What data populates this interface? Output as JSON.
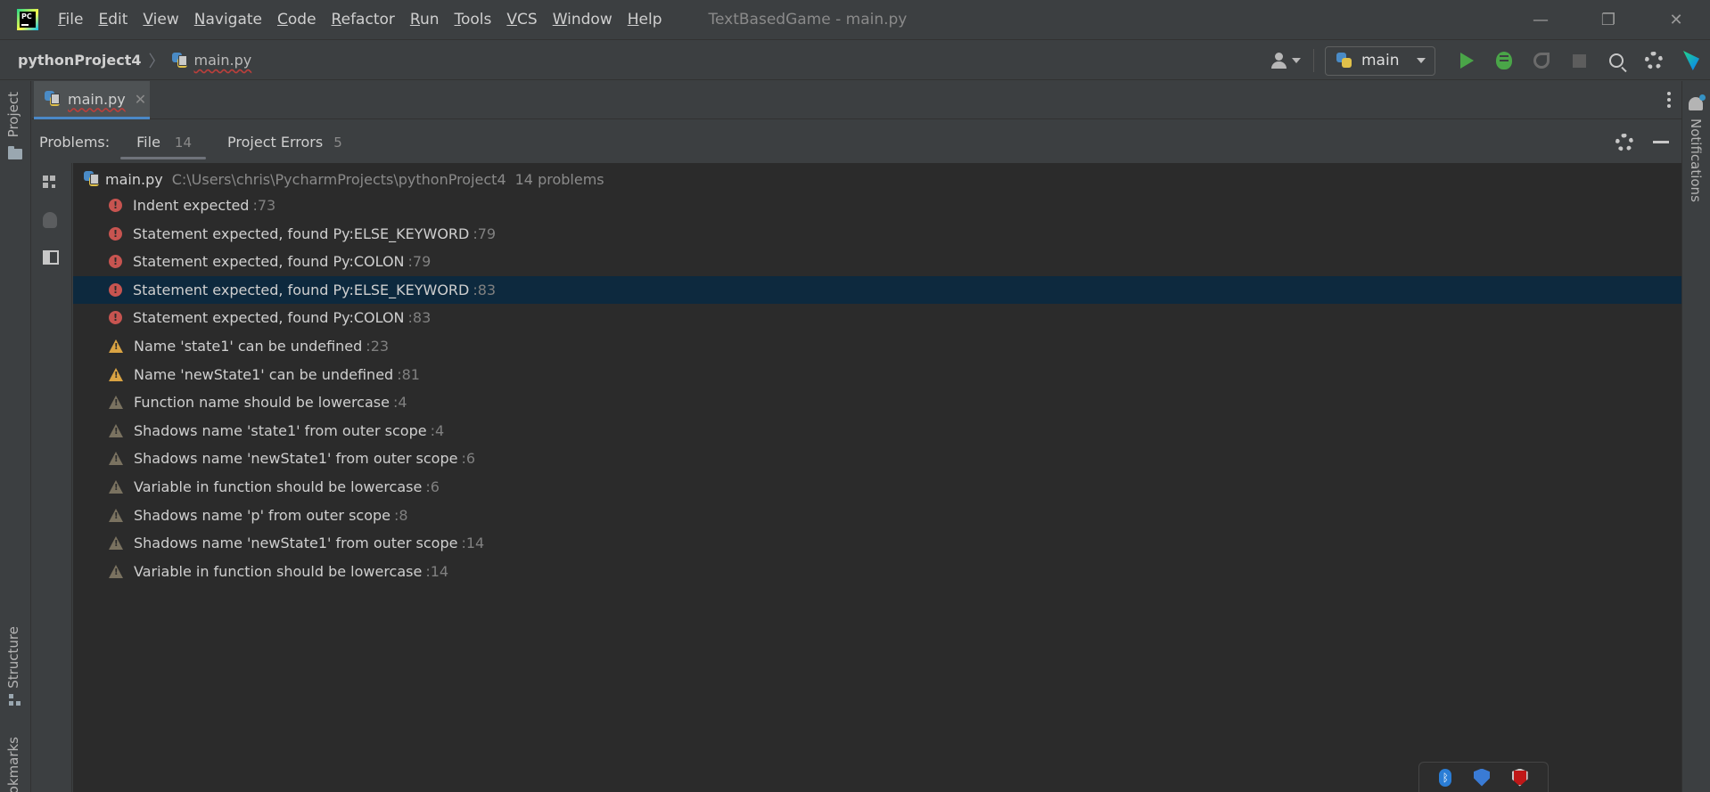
{
  "menubar": {
    "items": [
      {
        "label": "File",
        "mnemonic": "F",
        "rest": "ile"
      },
      {
        "label": "Edit",
        "mnemonic": "E",
        "rest": "dit"
      },
      {
        "label": "View",
        "mnemonic": "V",
        "rest": "iew"
      },
      {
        "label": "Navigate",
        "mnemonic": "N",
        "rest": "avigate"
      },
      {
        "label": "Code",
        "mnemonic": "C",
        "rest": "ode"
      },
      {
        "label": "Refactor",
        "mnemonic": "R",
        "rest": "efactor"
      },
      {
        "label": "Run",
        "mnemonic": "R",
        "rest": "un"
      },
      {
        "label": "Tools",
        "mnemonic": "T",
        "rest": "ools"
      },
      {
        "label": "VCS",
        "mnemonic": "V",
        "rest": "CS"
      },
      {
        "label": "Window",
        "mnemonic": "W",
        "rest": "indow"
      },
      {
        "label": "Help",
        "mnemonic": "H",
        "rest": "elp"
      }
    ],
    "window_title": "TextBasedGame - main.py",
    "controls": {
      "minimize": "—",
      "restore": "❐",
      "close": "✕"
    }
  },
  "navbar": {
    "project": "pythonProject4",
    "separator": "〉",
    "file": "main.py",
    "run_config": "main"
  },
  "left_stripe": {
    "project_label": "Project",
    "structure_label": "Structure",
    "bookmarks_label": "Bookmarks"
  },
  "right_stripe": {
    "notifications_label": "Notifications"
  },
  "editor": {
    "active_tab": "main.py",
    "close_glyph": "✕"
  },
  "problems": {
    "label": "Problems:",
    "tabs": [
      {
        "label": "File",
        "count": "14"
      },
      {
        "label": "Project Errors",
        "count": "5"
      }
    ],
    "file_node": {
      "name": "main.py",
      "path": "C:\\Users\\chris\\PycharmProjects\\pythonProject4",
      "count": "14 problems"
    },
    "items": [
      {
        "severity": "error",
        "message": "Indent expected",
        "line": ":73"
      },
      {
        "severity": "error",
        "message": "Statement expected, found Py:ELSE_KEYWORD",
        "line": ":79"
      },
      {
        "severity": "error",
        "message": "Statement expected, found Py:COLON",
        "line": ":79"
      },
      {
        "severity": "error",
        "message": "Statement expected, found Py:ELSE_KEYWORD",
        "line": ":83",
        "selected": true
      },
      {
        "severity": "error",
        "message": "Statement expected, found Py:COLON",
        "line": ":83"
      },
      {
        "severity": "warning",
        "message": "Name 'state1' can be undefined",
        "line": ":23"
      },
      {
        "severity": "warning",
        "message": "Name 'newState1' can be undefined",
        "line": ":81"
      },
      {
        "severity": "weak-warning",
        "message": "Function name should be lowercase",
        "line": ":4"
      },
      {
        "severity": "weak-warning",
        "message": "Shadows name 'state1' from outer scope",
        "line": ":4"
      },
      {
        "severity": "weak-warning",
        "message": "Shadows name 'newState1' from outer scope",
        "line": ":6"
      },
      {
        "severity": "weak-warning",
        "message": "Variable in function should be lowercase",
        "line": ":6"
      },
      {
        "severity": "weak-warning",
        "message": "Shadows name 'p' from outer scope",
        "line": ":8"
      },
      {
        "severity": "weak-warning",
        "message": "Shadows name 'newState1' from outer scope",
        "line": ":14"
      },
      {
        "severity": "weak-warning",
        "message": "Variable in function should be lowercase",
        "line": ":14"
      }
    ]
  },
  "colors": {
    "error": "#c75450",
    "warning": "#d9a343",
    "weak_warning": "#7a7260",
    "selection": "#0d293e",
    "run_green": "#4aa548"
  },
  "icons": {
    "app": "pycharm-logo-icon",
    "python_file": "python-file-icon",
    "user": "user-icon",
    "run": "play-icon",
    "debug": "bug-icon",
    "coverage": "coverage-icon",
    "stop": "stop-icon",
    "search": "search-icon",
    "settings": "gear-icon",
    "notifications": "bell-icon",
    "tray_bluetooth": "bluetooth-icon",
    "tray_security": "shield-icon",
    "tray_antivirus": "mcafee-icon"
  },
  "tray": {
    "bluetooth_glyph": "ᛒ"
  }
}
